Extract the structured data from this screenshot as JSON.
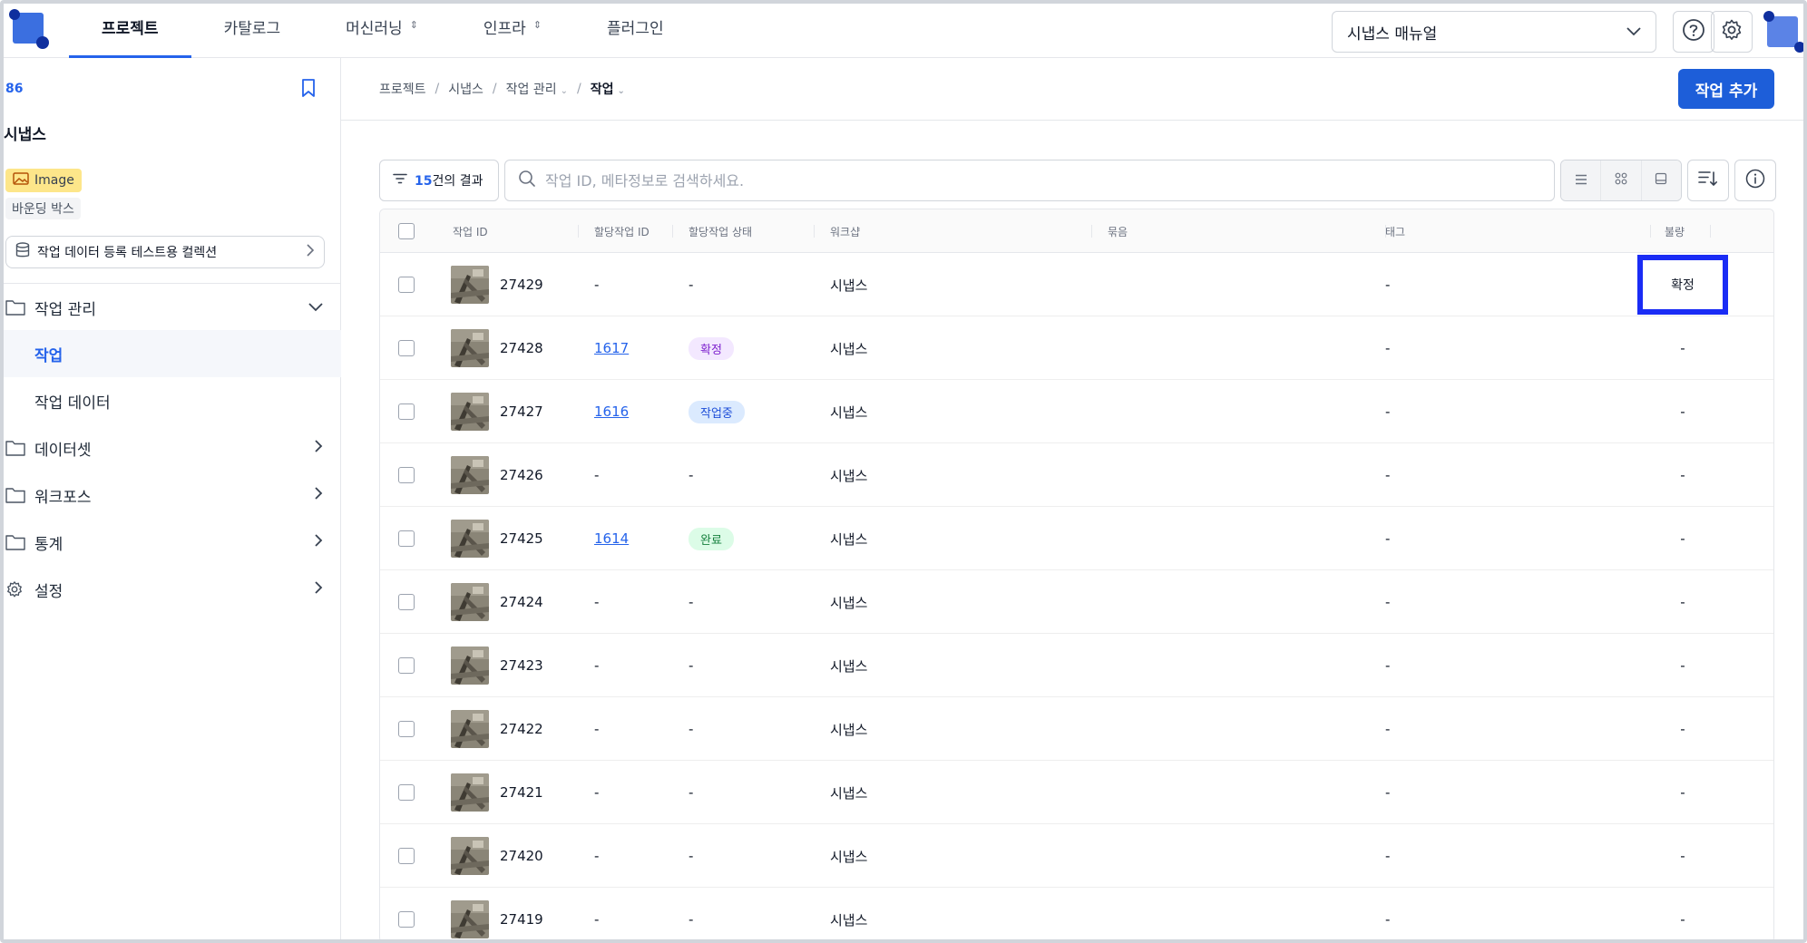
{
  "topnav": {
    "tabs": [
      {
        "label": "프로젝트",
        "active": true,
        "has_dropdown": false
      },
      {
        "label": "카탈로그",
        "active": false,
        "has_dropdown": false
      },
      {
        "label": "머신러닝",
        "active": false,
        "has_dropdown": true
      },
      {
        "label": "인프라",
        "active": false,
        "has_dropdown": true
      },
      {
        "label": "플러그인",
        "active": false,
        "has_dropdown": false
      }
    ],
    "project_select": "시냅스 매뉴얼",
    "accent_color": "#2563eb"
  },
  "sidebar": {
    "project_id": "86",
    "project_name": "시냅스",
    "data_type": "Image",
    "annotation_type": "바운딩 박스",
    "collection": "작업 데이터 등록 테스트용 컬렉션",
    "menu": {
      "task_mgmt": "작업 관리",
      "task": "작업",
      "task_data": "작업 데이터",
      "dataset": "데이터셋",
      "workforce": "워크포스",
      "stats": "통계",
      "settings": "설정"
    }
  },
  "main": {
    "breadcrumb": [
      "프로젝트",
      "시냅스",
      "작업 관리",
      "작업"
    ],
    "add_button": "작업 추가",
    "result_count": "15",
    "result_suffix": "건의 결과",
    "search_placeholder": "작업 ID, 메타정보로 검색하세요."
  },
  "table": {
    "columns": {
      "task_id": "작업 ID",
      "assign_id": "할당작업 ID",
      "assign_status": "할당작업 상태",
      "workshop": "워크샵",
      "group": "묶음",
      "tag": "태그",
      "flag": "불량"
    },
    "rows": [
      {
        "id": "27429",
        "assign_id": "-",
        "status": "-",
        "workshop": "시냅스",
        "tag": "-",
        "flag": "확정"
      },
      {
        "id": "27428",
        "assign_id": "1617",
        "status": "확정",
        "workshop": "시냅스",
        "tag": "-",
        "flag": "-"
      },
      {
        "id": "27427",
        "assign_id": "1616",
        "status": "작업중",
        "workshop": "시냅스",
        "tag": "-",
        "flag": "-"
      },
      {
        "id": "27426",
        "assign_id": "-",
        "status": "-",
        "workshop": "시냅스",
        "tag": "-",
        "flag": "-"
      },
      {
        "id": "27425",
        "assign_id": "1614",
        "status": "완료",
        "workshop": "시냅스",
        "tag": "-",
        "flag": "-"
      },
      {
        "id": "27424",
        "assign_id": "-",
        "status": "-",
        "workshop": "시냅스",
        "tag": "-",
        "flag": "-"
      },
      {
        "id": "27423",
        "assign_id": "-",
        "status": "-",
        "workshop": "시냅스",
        "tag": "-",
        "flag": "-"
      },
      {
        "id": "27422",
        "assign_id": "-",
        "status": "-",
        "workshop": "시냅스",
        "tag": "-",
        "flag": "-"
      },
      {
        "id": "27421",
        "assign_id": "-",
        "status": "-",
        "workshop": "시냅스",
        "tag": "-",
        "flag": "-"
      },
      {
        "id": "27420",
        "assign_id": "-",
        "status": "-",
        "workshop": "시냅스",
        "tag": "-",
        "flag": "-"
      },
      {
        "id": "27419",
        "assign_id": "-",
        "status": "-",
        "workshop": "시냅스",
        "tag": "-",
        "flag": "-"
      }
    ],
    "status_colors": {
      "확정": {
        "bg": "#f3e8ff",
        "fg": "#7e22ce"
      },
      "작업중": {
        "bg": "#dbeafe",
        "fg": "#1d4ed8"
      },
      "완료": {
        "bg": "#dcfce7",
        "fg": "#15803d"
      }
    },
    "highlight_color": "#1a2cf5"
  }
}
